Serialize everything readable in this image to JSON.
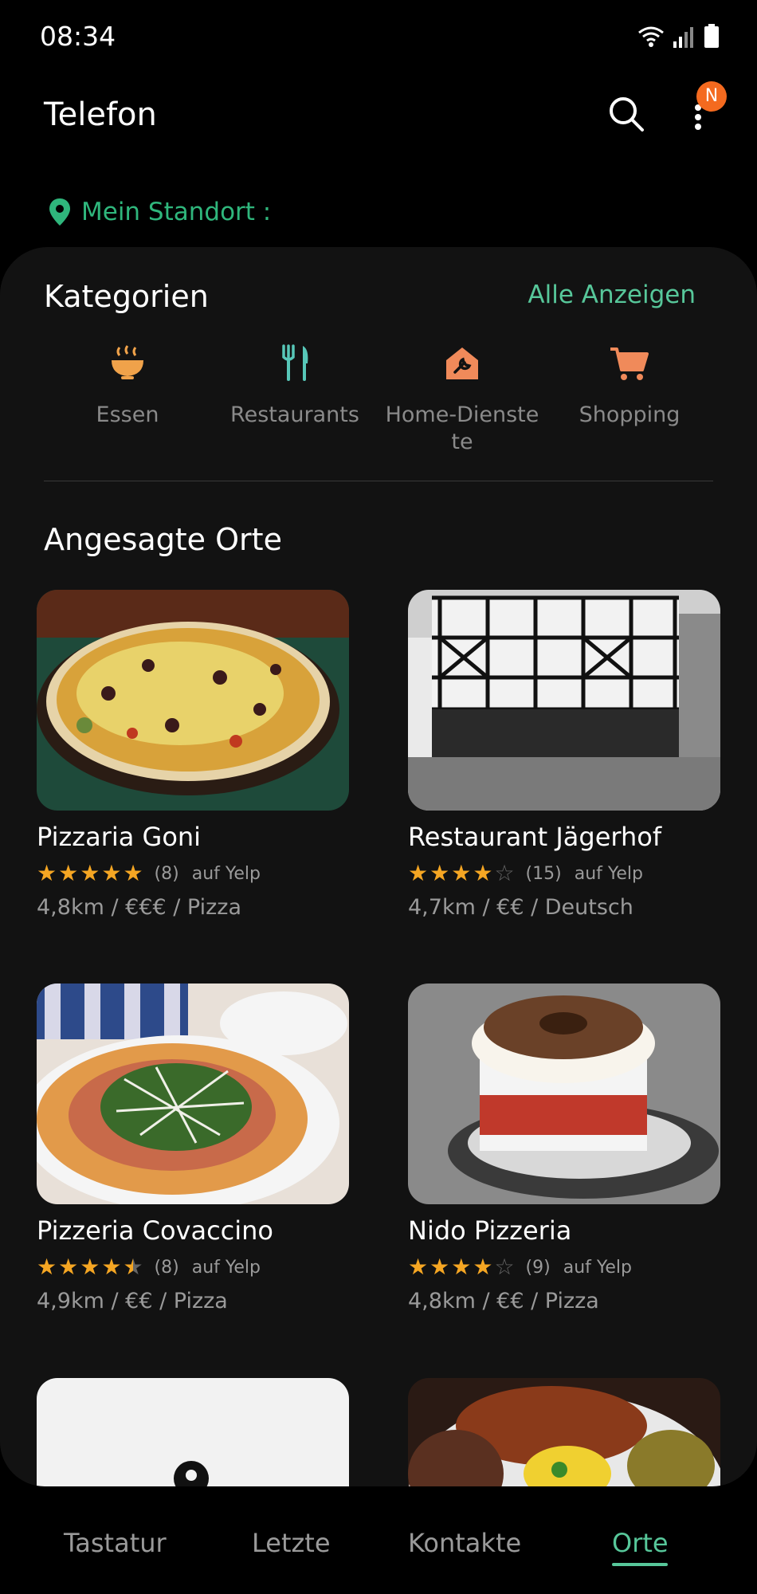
{
  "status_bar": {
    "time": "08:34"
  },
  "app_bar": {
    "title": "Telefon",
    "badge": "N"
  },
  "location": {
    "label": "Mein Standort :"
  },
  "categories": {
    "title": "Kategorien",
    "show_all": "Alle Anzeigen",
    "items": [
      {
        "label": "Essen",
        "icon": "bowl-icon",
        "color": "#f0a24a"
      },
      {
        "label": "Restaurants",
        "icon": "fork-knife-icon",
        "color": "#57c7b8"
      },
      {
        "label": "Home-Dienste",
        "label_line1": "Home-Dienste",
        "label_line2": "te",
        "icon": "home-service-icon",
        "color": "#f08a5a"
      },
      {
        "label": "Shopping",
        "icon": "shopping-cart-icon",
        "color": "#f08a5a"
      }
    ]
  },
  "trending": {
    "title": "Angesagte Orte",
    "places": [
      {
        "name": "Pizzaria Goni",
        "rating": 5,
        "count": "(8)",
        "source": "auf Yelp",
        "meta": "4,8km / €€€ / Pizza"
      },
      {
        "name": "Restaurant Jägerhof",
        "rating": 4,
        "count": "(15)",
        "source": "auf Yelp",
        "meta": "4,7km / €€ / Deutsch"
      },
      {
        "name": "Pizzeria Covaccino",
        "rating": 4.5,
        "count": "(8)",
        "source": "auf Yelp",
        "meta": "4,9km / €€ / Pizza"
      },
      {
        "name": "Nido Pizzeria",
        "rating": 4,
        "count": "(9)",
        "source": "auf Yelp",
        "meta": "4,8km / €€ / Pizza"
      }
    ]
  },
  "bottom_nav": {
    "items": [
      "Tastatur",
      "Letzte",
      "Kontakte",
      "Orte"
    ],
    "active": "Orte"
  },
  "colors": {
    "accent": "#57c79a",
    "location": "#2fb67c",
    "star": "#f5a623",
    "badge": "#f46a1f"
  }
}
